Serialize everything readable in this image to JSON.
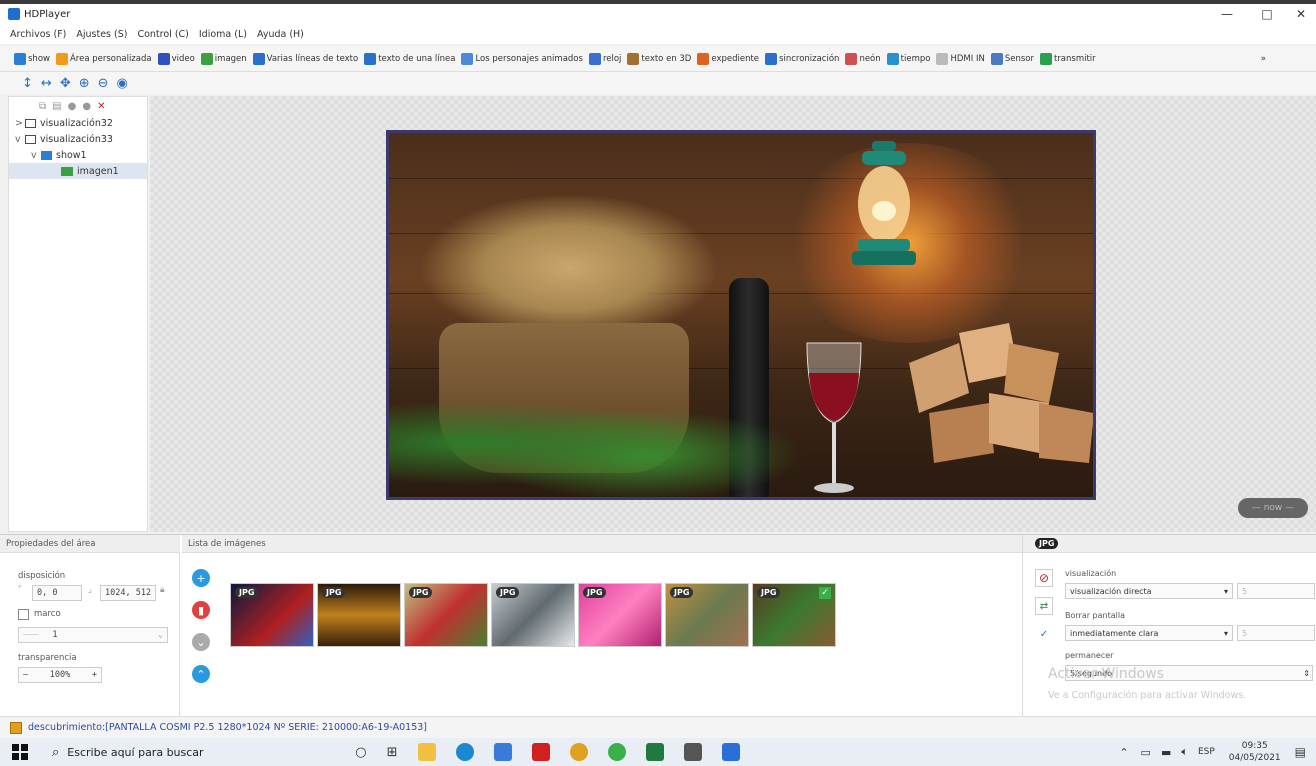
{
  "window": {
    "title": "HDPlayer",
    "minimize": "—",
    "maximize": "□",
    "close": "✕"
  },
  "menu": [
    "Archivos (F)",
    "Ajustes (S)",
    "Control (C)",
    "Idioma (L)",
    "Ayuda (H)"
  ],
  "toolbar": {
    "items": [
      {
        "label": "show",
        "color": "#2a7fd4"
      },
      {
        "label": "Área personalizada",
        "color": "#f09a1a"
      },
      {
        "label": "video",
        "color": "#3050c0"
      },
      {
        "label": "imagen",
        "color": "#3aa040"
      },
      {
        "label": "Varias líneas de texto",
        "color": "#2a6fc9"
      },
      {
        "label": "texto de una línea",
        "color": "#2a6fc9"
      },
      {
        "label": "Los personajes animados",
        "color": "#4a8ad8"
      },
      {
        "label": "reloj",
        "color": "#3a6fd0"
      },
      {
        "label": "texto en 3D",
        "color": "#a07030"
      },
      {
        "label": "expediente",
        "color": "#e06020"
      },
      {
        "label": "sincronización",
        "color": "#2a6fc9"
      },
      {
        "label": "neón",
        "color": "#d05050"
      },
      {
        "label": "tiempo",
        "color": "#2a8fd0"
      },
      {
        "label": "HDMI IN",
        "color": "#bbbbbb"
      },
      {
        "label": "Sensor",
        "color": "#4a7ac0"
      },
      {
        "label": "transmitir",
        "color": "#28a050"
      }
    ],
    "overflow": "»"
  },
  "tree": {
    "items": [
      {
        "label": "visualización32",
        "expander": ">"
      },
      {
        "label": "visualización33",
        "expander": "v"
      },
      {
        "label": "show1",
        "expander": "v"
      },
      {
        "label": "imagen1",
        "expander": ""
      }
    ]
  },
  "canvas": {
    "now_button": "— now —"
  },
  "props": {
    "header": "Propiedades del área",
    "position_label": "disposición",
    "position_value": "0, 0",
    "size_value": "1024, 512",
    "frame_label": "marco",
    "frame_value": "1",
    "transparency_label": "transparencia",
    "transparency_value": "100%",
    "minus": "—",
    "plus": "+"
  },
  "imagelist": {
    "header": "Lista de imágenes",
    "thumbs": [
      {
        "tag": "JPG",
        "bg": "linear-gradient(135deg,#0a1a40,#b02020 60%,#3060c0)"
      },
      {
        "tag": "JPG",
        "bg": "linear-gradient(180deg,#2a1a08,#c08020 50%,#3a2008)"
      },
      {
        "tag": "JPG",
        "bg": "linear-gradient(135deg,#c0c080,#c03030 50%,#4a8030)"
      },
      {
        "tag": "JPG",
        "bg": "linear-gradient(135deg,#c8ccd0,#606a70 50%,#e8eaec)"
      },
      {
        "tag": "JPG",
        "bg": "linear-gradient(135deg,#e040a0,#ff80c0 50%,#b02070)"
      },
      {
        "tag": "JPG",
        "bg": "linear-gradient(135deg,#c09040,#6a7a50 50%,#a07050)"
      },
      {
        "tag": "JPG",
        "bg": "linear-gradient(135deg,#5a3a20,#3a7a30 50%,#8a5a30)"
      }
    ]
  },
  "rightpanel": {
    "tag": "JPG",
    "display_label": "visualización",
    "display_value": "visualización directa",
    "display_speed": "5",
    "clear_label": "Borrar pantalla",
    "clear_value": "inmediatamente clara",
    "clear_speed": "5",
    "stay_label": "permanecer",
    "stay_value": "5/segundo"
  },
  "watermark": {
    "line1": "Activar Windows",
    "line2": "Ve a Configuración para activar Windows."
  },
  "status": {
    "text": "descubrimiento:[PANTALLA COSMI P2.5 1280*1024 Nº SERIE: 210000:A6-19-A0153]"
  },
  "taskbar": {
    "search_placeholder": "Escribe aquí para buscar",
    "lang": "ESP",
    "time": "09:35",
    "date": "04/05/2021"
  }
}
